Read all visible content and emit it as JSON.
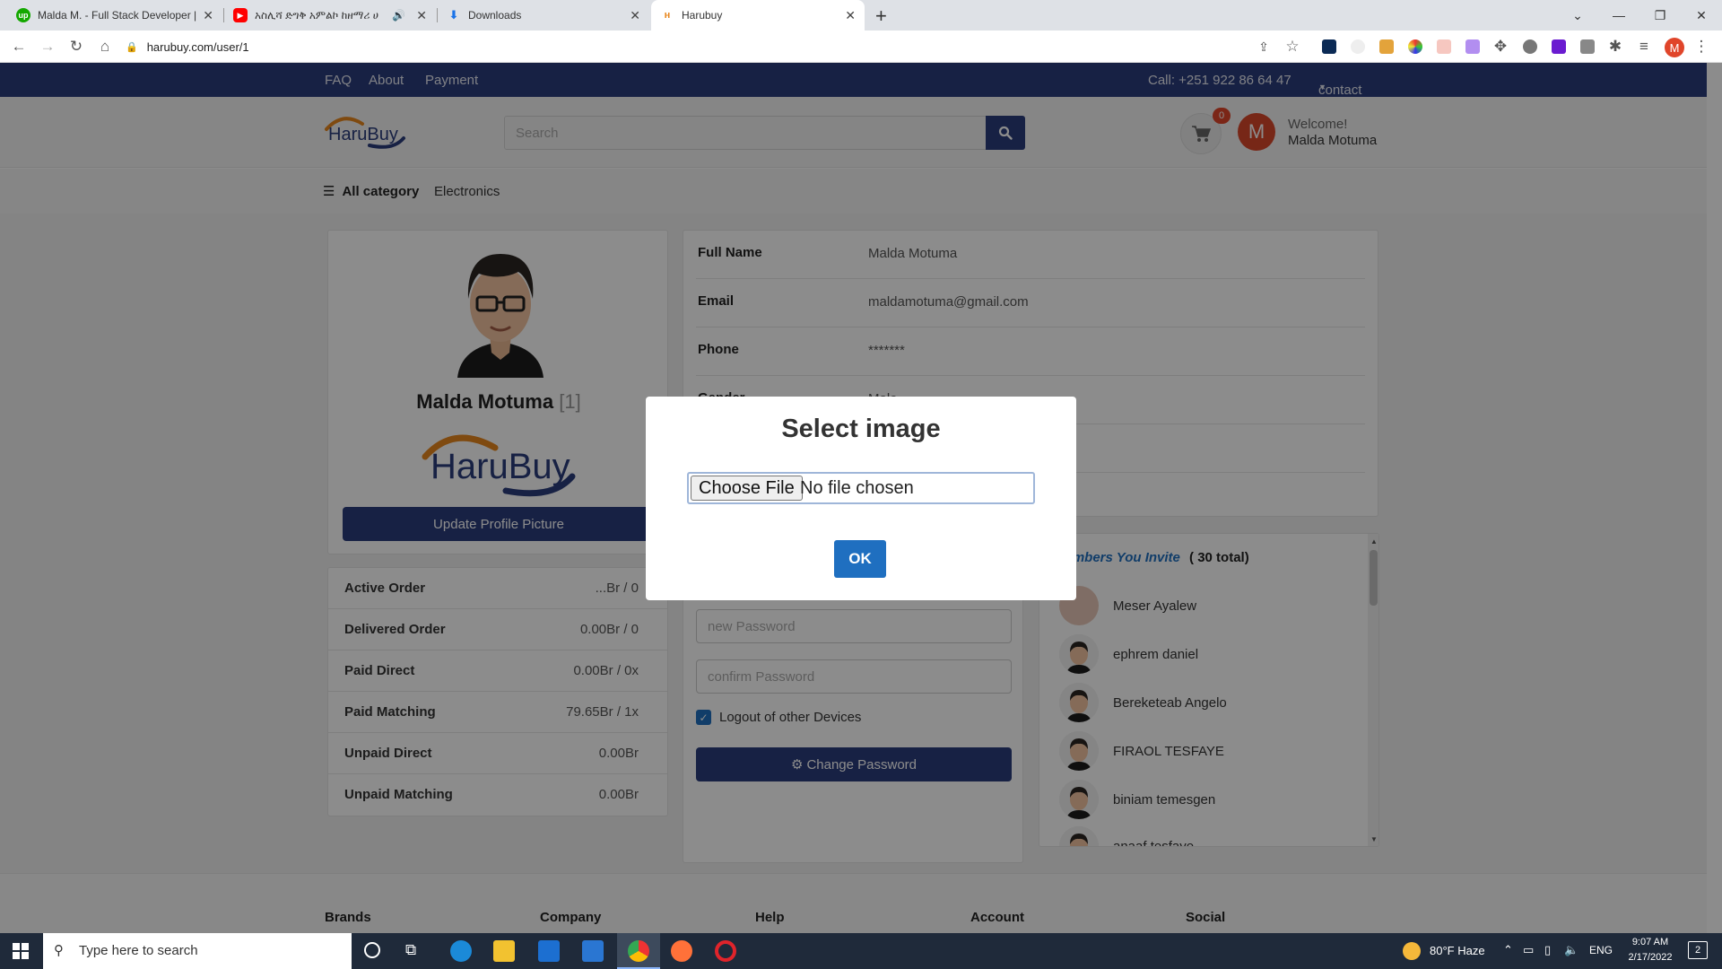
{
  "browser": {
    "tabs": [
      {
        "title": "Malda M. - Full Stack Developer |"
      },
      {
        "title": "አስሊሻ ድግቅ አምልኮ ከዘማሪ ሀ"
      },
      {
        "title": "Downloads"
      },
      {
        "title": "Harubuy"
      }
    ],
    "url": "harubuy.com/user/1",
    "profile_initial": "M"
  },
  "topnav": {
    "links": [
      "FAQ",
      "About",
      "Payment"
    ],
    "phone": "Call: +251 922 86 64 47",
    "contact": "contact"
  },
  "header": {
    "search_placeholder": "Search",
    "cart_count": "0",
    "welcome": "Welcome!",
    "user_name": "Malda Motuma",
    "avatar_initial": "M"
  },
  "catbar": {
    "all_category": "All category",
    "electronics": "Electronics"
  },
  "profile": {
    "name": "Malda Motuma",
    "level": "[1]",
    "update_button": "Update Profile Picture"
  },
  "stats": [
    {
      "label": "Active Order",
      "value": "...Br / 0"
    },
    {
      "label": "Delivered Order",
      "value": "0.00Br / 0"
    },
    {
      "label": "Paid Direct",
      "value": "0.00Br / 0x"
    },
    {
      "label": "Paid Matching",
      "value": "79.65Br / 1x"
    },
    {
      "label": "Unpaid Direct",
      "value": "0.00Br"
    },
    {
      "label": "Unpaid Matching",
      "value": "0.00Br"
    }
  ],
  "info": [
    {
      "label": "Full Name",
      "value": "Malda Motuma"
    },
    {
      "label": "Email",
      "value": "maldamotuma@gmail.com"
    },
    {
      "label": "Phone",
      "value": "*******"
    },
    {
      "label": "Gender",
      "value": "Male"
    }
  ],
  "password": {
    "new_placeholder": "new Password",
    "confirm_placeholder": "confirm Password",
    "logout_label": "Logout of other Devices",
    "change_button": "Change Password"
  },
  "members": {
    "title": "Members You Invite",
    "total": "( 30 total)",
    "list": [
      "Meser Ayalew",
      "ephrem daniel",
      "Bereketeab Angelo",
      "FIRAOL TESFAYE",
      "biniam temesgen",
      "anaaf tesfaye"
    ]
  },
  "footer": {
    "columns": [
      "Brands",
      "Company",
      "Help",
      "Account",
      "Social"
    ]
  },
  "modal": {
    "title": "Select image",
    "choose_file": "Choose File",
    "no_file": "No file chosen",
    "ok": "OK"
  },
  "taskbar": {
    "search_placeholder": "Type here to search",
    "weather": "80°F  Haze",
    "lang": "ENG",
    "time": "9:07 AM",
    "date": "2/17/2022",
    "notif": "2"
  },
  "colors": {
    "navy": "#2b3d7c",
    "ok_blue": "#1f6fc0",
    "brand_orange": "#e8871e",
    "brand_navy": "#2b3d7c"
  }
}
